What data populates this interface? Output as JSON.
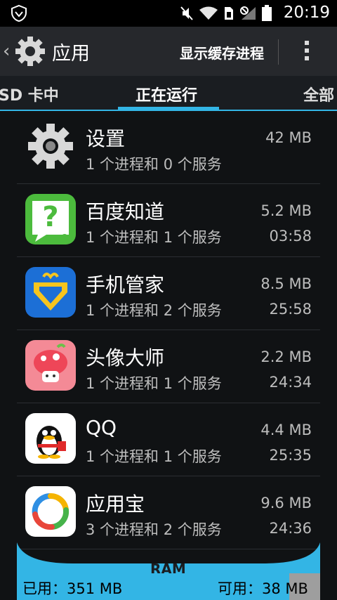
{
  "status_bar": {
    "time": "20:19"
  },
  "action_bar": {
    "title": "应用",
    "action": "显示缓存进程"
  },
  "tabs": [
    {
      "label": "SD 卡中"
    },
    {
      "label": "正在运行"
    },
    {
      "label": "全部"
    }
  ],
  "apps": [
    {
      "name": "设置",
      "detail": "1 个进程和 0 个服务",
      "size": "42 MB",
      "time": ""
    },
    {
      "name": "百度知道",
      "detail": "1 个进程和 1 个服务",
      "size": "5.2 MB",
      "time": "03:58"
    },
    {
      "name": "手机管家",
      "detail": "1 个进程和 2 个服务",
      "size": "8.5 MB",
      "time": "25:58"
    },
    {
      "name": "头像大师",
      "detail": "1 个进程和 1 个服务",
      "size": "2.2 MB",
      "time": "24:34"
    },
    {
      "name": "QQ",
      "detail": "1 个进程和 1 个服务",
      "size": "4.4 MB",
      "time": "25:35"
    },
    {
      "name": "应用宝",
      "detail": "3 个进程和 2 个服务",
      "size": "9.6 MB",
      "time": "24:36"
    }
  ],
  "ram": {
    "label": "RAM",
    "used": "已用：351 MB",
    "available": "可用：38 MB"
  }
}
